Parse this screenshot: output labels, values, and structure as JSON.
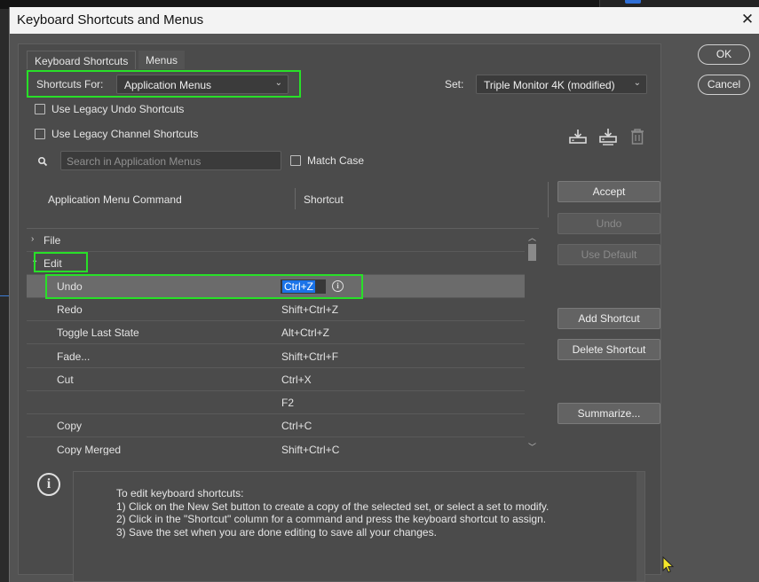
{
  "dialog": {
    "title": "Keyboard Shortcuts and Menus",
    "close_glyph": "✕"
  },
  "tabs": [
    {
      "label": "Keyboard Shortcuts",
      "active": true
    },
    {
      "label": "Menus",
      "active": false
    }
  ],
  "shortcuts_for": {
    "label": "Shortcuts For:",
    "value": "Application Menus"
  },
  "set": {
    "label": "Set:",
    "value": "Triple Monitor 4K (modified)"
  },
  "options": {
    "legacy_undo": {
      "label": "Use Legacy Undo Shortcuts",
      "checked": false
    },
    "legacy_channel": {
      "label": "Use Legacy Channel Shortcuts",
      "checked": false
    },
    "match_case": {
      "label": "Match Case",
      "checked": false
    }
  },
  "search": {
    "placeholder": "Search in Application Menus",
    "value": ""
  },
  "columns": {
    "command": "Application Menu Command",
    "shortcut": "Shortcut"
  },
  "rows": [
    {
      "type": "group",
      "caret": "›",
      "command": "File",
      "shortcut": ""
    },
    {
      "type": "group",
      "caret": "⌄",
      "command": "Edit",
      "shortcut": ""
    },
    {
      "type": "item",
      "command": "Undo",
      "shortcut": "Ctrl+Z",
      "editing": true
    },
    {
      "type": "item",
      "command": "Redo",
      "shortcut": "Shift+Ctrl+Z"
    },
    {
      "type": "item",
      "command": "Toggle Last State",
      "shortcut": "Alt+Ctrl+Z"
    },
    {
      "type": "item",
      "command": "Fade...",
      "shortcut": "Shift+Ctrl+F"
    },
    {
      "type": "item",
      "command": "Cut",
      "shortcut": "Ctrl+X"
    },
    {
      "type": "item",
      "command": "",
      "shortcut": "F2"
    },
    {
      "type": "item",
      "command": "Copy",
      "shortcut": "Ctrl+C"
    },
    {
      "type": "item",
      "command": "Copy Merged",
      "shortcut": "Shift+Ctrl+C"
    }
  ],
  "buttons": {
    "ok": "OK",
    "cancel": "Cancel",
    "accept": "Accept",
    "undo": "Undo",
    "use_default": "Use Default",
    "add_shortcut": "Add Shortcut",
    "delete_shortcut": "Delete Shortcut",
    "summarize": "Summarize..."
  },
  "help": {
    "text": "To edit keyboard shortcuts:\n1) Click on the New Set button to create a copy of the selected set, or select a set to modify.\n2) Click in the \"Shortcut\" column for a command and press the keyboard shortcut to assign.\n3) Save the set when you are done editing to save all your changes."
  },
  "colors": {
    "dialog_bg": "#535353",
    "panel_bg": "#4b4b4b",
    "highlight_box": "#28e028",
    "selection_blue": "#1a73e8"
  },
  "icons": [
    "save-set-icon",
    "save-set-as-icon",
    "delete-set-icon",
    "search-icon",
    "info-icon",
    "chevron-down-icon",
    "close-icon"
  ]
}
